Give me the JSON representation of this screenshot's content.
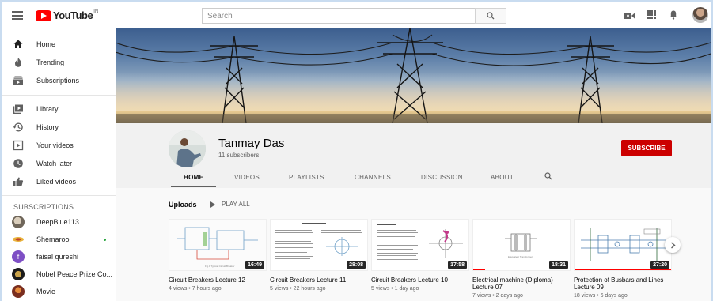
{
  "header": {
    "logo_text": "YouTube",
    "logo_sup": "IN",
    "search_placeholder": "Search"
  },
  "sidebar": {
    "main": [
      {
        "label": "Home",
        "icon": "home-icon"
      },
      {
        "label": "Trending",
        "icon": "trending-icon"
      },
      {
        "label": "Subscriptions",
        "icon": "subscriptions-icon"
      }
    ],
    "library": [
      {
        "label": "Library",
        "icon": "library-icon"
      },
      {
        "label": "History",
        "icon": "history-icon"
      },
      {
        "label": "Your videos",
        "icon": "your-videos-icon"
      },
      {
        "label": "Watch later",
        "icon": "watch-later-icon"
      },
      {
        "label": "Liked videos",
        "icon": "liked-videos-icon"
      }
    ],
    "subscriptions_heading": "SUBSCRIPTIONS",
    "subscriptions": [
      {
        "label": "DeepBlue113",
        "color": "#8a7d6d"
      },
      {
        "label": "Shemaroo",
        "color": "#e8b23a"
      },
      {
        "label": "faisal qureshi",
        "color": "#7e4fc5"
      },
      {
        "label": "Nobel Peace Prize Co...",
        "color": "#1b1b1b"
      },
      {
        "label": "Movie",
        "color": "#7a2e1f"
      }
    ]
  },
  "channel": {
    "name": "Tanmay Das",
    "subscribers": "11 subscribers",
    "subscribe_label": "SUBSCRIBE",
    "tabs": [
      "HOME",
      "VIDEOS",
      "PLAYLISTS",
      "CHANNELS",
      "DISCUSSION",
      "ABOUT"
    ],
    "active_tab": "HOME"
  },
  "uploads": {
    "heading": "Uploads",
    "play_all": "PLAY ALL",
    "videos": [
      {
        "title": "Circuit Breakers Lecture 12",
        "meta": "4 views • 7 hours ago",
        "duration": "16:49",
        "progress": 0
      },
      {
        "title": "Circuit Breakers Lecture 11",
        "meta": "5 views • 22 hours ago",
        "duration": "28:08",
        "progress": 0
      },
      {
        "title": "Circuit Breakers Lecture 10",
        "meta": "5 views • 1 day ago",
        "duration": "17:58",
        "progress": 0
      },
      {
        "title": "Electrical machine (Diploma) Lecture 07",
        "meta": "7 views • 2 days ago",
        "duration": "18:31",
        "progress": 0.12
      },
      {
        "title": "Protection of Busbars and Lines Lecture 09",
        "meta": "18 views • 6 days ago",
        "duration": "27:20",
        "progress": 1
      }
    ]
  },
  "colors": {
    "brand_red": "#ff0000",
    "subscribe_red": "#cc0000"
  }
}
